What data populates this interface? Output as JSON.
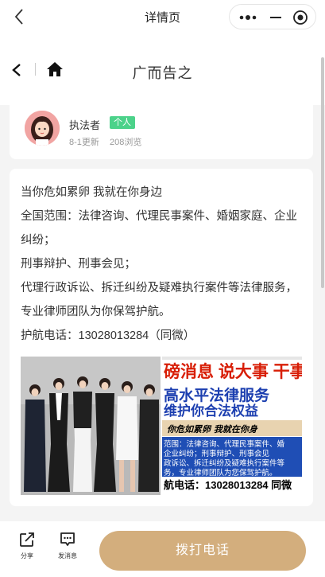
{
  "topbar": {
    "title": "详情页",
    "icons": [
      "back-chevron-icon",
      "more-dots-icon",
      "minimize-icon",
      "close-target-icon"
    ]
  },
  "pagenav": {
    "title": "广而告之",
    "icons": [
      "back-chevron-icon",
      "home-icon"
    ]
  },
  "author": {
    "name": "执法者",
    "badge": "个人",
    "updated": "8-1更新",
    "views": "208浏览"
  },
  "content": {
    "lines": [
      "当你危如累卵  我就在你身边",
      "全国范围：法律咨询、代理民事案件、婚姻家庭、企业纠纷；",
      "刑事辩护、刑事会见；",
      "代理行政诉讼、拆迁纠纷及疑难执行案件等法律服务，专业律师团队为你保驾护航。",
      "护航电话：13028013284（同微）"
    ]
  },
  "poster": {
    "headline": "磅消息  说大事  干事",
    "blue_line1": "高水平法律服务",
    "blue_line2": "维护你合法权益",
    "slogan": "你危如累卵   我就在你身",
    "body_lines": [
      "范围：法律咨询、代理民事案件、婚",
      "企业纠纷；刑事辩护、刑事会见",
      "政诉讼、拆迁纠纷及疑难执行案件等",
      "务，专业律师团队为您保驾护航。"
    ],
    "phone": "航电话：13028013284  同微"
  },
  "bottom": {
    "share_label": "分享",
    "message_label": "发消息",
    "call_label": "拨打电话"
  },
  "colors": {
    "accent_gold": "#d3ae7d",
    "badge_green": "#4cd28a",
    "poster_red": "#d81e06",
    "poster_blue": "#1c3fb0"
  }
}
